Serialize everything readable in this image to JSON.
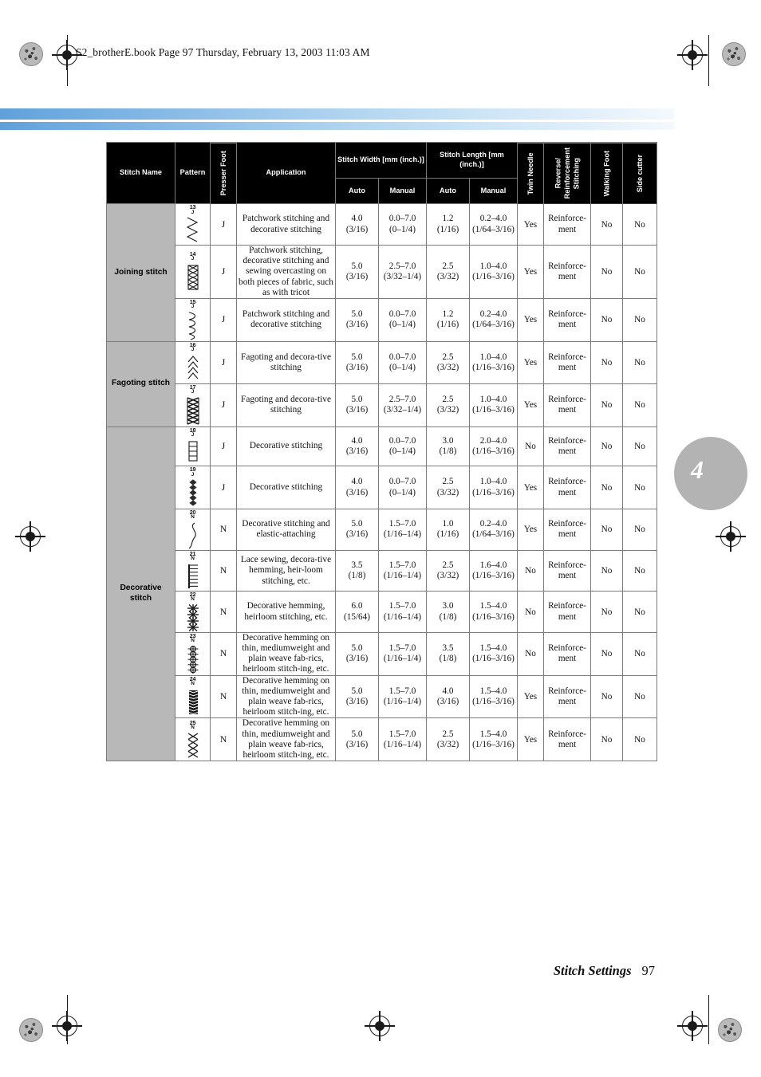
{
  "page_header": "S2_brotherE.book  Page 97  Thursday, February 13, 2003  11:03 AM",
  "chapter_badge": "4",
  "footer": {
    "title": "Stitch Settings",
    "page_number": "97"
  },
  "table": {
    "headers": {
      "stitch_name": "Stitch Name",
      "pattern": "Pattern",
      "presser_foot": "Presser Foot",
      "application": "Application",
      "stitch_width": "Stitch Width",
      "stitch_width_units": "[mm (inch.)]",
      "stitch_length": "Stitch Length",
      "stitch_length_units": "[mm (inch.)]",
      "auto": "Auto",
      "manual": "Manual",
      "auto2": "Auto",
      "manual2": "Manual",
      "twin_needle": "Twin Needle",
      "reverse_line1": "Reverse/",
      "reverse_line2": "Reinforcement",
      "reverse_line3": "Stitching",
      "walking_foot": "Walking Foot",
      "side_cutter": "Side cutter"
    },
    "groups": [
      {
        "label": "Joining stitch",
        "rows": 3
      },
      {
        "label": "Fagoting stitch",
        "rows": 2
      },
      {
        "label": "Decorative\nstitch",
        "rows": 8
      }
    ],
    "rows": [
      {
        "num": "13",
        "foot_mark": "J",
        "glyph": "zigzag-soft",
        "presser_foot": "J",
        "application": "Patchwork stitching and decorative stitching",
        "width_auto": "4.0",
        "width_auto_in": "(3/16)",
        "width_manual": "0.0–7.0",
        "width_manual_in": "(0–1/4)",
        "length_auto": "1.2",
        "length_auto_in": "(1/16)",
        "length_manual": "0.2–4.0",
        "length_manual_in": "(1/64–3/16)",
        "twin_needle": "Yes",
        "reverse": "Reinforce-\nment",
        "walking_foot": "No",
        "side_cutter": "No"
      },
      {
        "num": "14",
        "foot_mark": "J",
        "glyph": "cross-box",
        "presser_foot": "J",
        "application": "Patchwork stitching, decorative stitching and sewing overcasting on both pieces of fabric, such as with tricot",
        "width_auto": "5.0",
        "width_auto_in": "(3/16)",
        "width_manual": "2.5–7.0",
        "width_manual_in": "(3/32–1/4)",
        "length_auto": "2.5",
        "length_auto_in": "(3/32)",
        "length_manual": "1.0–4.0",
        "length_manual_in": "(1/16–3/16)",
        "twin_needle": "Yes",
        "reverse": "Reinforce-\nment",
        "walking_foot": "No",
        "side_cutter": "No"
      },
      {
        "num": "15",
        "foot_mark": "J",
        "glyph": "zigzag-wave",
        "presser_foot": "J",
        "application": "Patchwork stitching and decorative stitching",
        "width_auto": "5.0",
        "width_auto_in": "(3/16)",
        "width_manual": "0.0–7.0",
        "width_manual_in": "(0–1/4)",
        "length_auto": "1.2",
        "length_auto_in": "(1/16)",
        "length_manual": "0.2–4.0",
        "length_manual_in": "(1/64–3/16)",
        "twin_needle": "Yes",
        "reverse": "Reinforce-\nment",
        "walking_foot": "No",
        "side_cutter": "No"
      },
      {
        "num": "16",
        "foot_mark": "J",
        "glyph": "chevron",
        "presser_foot": "J",
        "application": "Fagoting and decora-tive stitching",
        "width_auto": "5.0",
        "width_auto_in": "(3/16)",
        "width_manual": "0.0–7.0",
        "width_manual_in": "(0–1/4)",
        "length_auto": "2.5",
        "length_auto_in": "(3/32)",
        "length_manual": "1.0–4.0",
        "length_manual_in": "(1/16–3/16)",
        "twin_needle": "Yes",
        "reverse": "Reinforce-\nment",
        "walking_foot": "No",
        "side_cutter": "No"
      },
      {
        "num": "17",
        "foot_mark": "J",
        "glyph": "dense-cross",
        "presser_foot": "J",
        "application": "Fagoting and decora-tive stitching",
        "width_auto": "5.0",
        "width_auto_in": "(3/16)",
        "width_manual": "2.5–7.0",
        "width_manual_in": "(3/32–1/4)",
        "length_auto": "2.5",
        "length_auto_in": "(3/32)",
        "length_manual": "1.0–4.0",
        "length_manual_in": "(1/16–3/16)",
        "twin_needle": "Yes",
        "reverse": "Reinforce-\nment",
        "walking_foot": "No",
        "side_cutter": "No"
      },
      {
        "num": "18",
        "foot_mark": "J",
        "glyph": "ladder",
        "presser_foot": "J",
        "application": "Decorative stitching",
        "width_auto": "4.0",
        "width_auto_in": "(3/16)",
        "width_manual": "0.0–7.0",
        "width_manual_in": "(0–1/4)",
        "length_auto": "3.0",
        "length_auto_in": "(1/8)",
        "length_manual": "2.0–4.0",
        "length_manual_in": "(1/16–3/16)",
        "twin_needle": "No",
        "reverse": "Reinforce-\nment",
        "walking_foot": "No",
        "side_cutter": "No"
      },
      {
        "num": "19",
        "foot_mark": "J",
        "glyph": "diamond-chain",
        "presser_foot": "J",
        "application": "Decorative stitching",
        "width_auto": "4.0",
        "width_auto_in": "(3/16)",
        "width_manual": "0.0–7.0",
        "width_manual_in": "(0–1/4)",
        "length_auto": "2.5",
        "length_auto_in": "(3/32)",
        "length_manual": "1.0–4.0",
        "length_manual_in": "(1/16–3/16)",
        "twin_needle": "Yes",
        "reverse": "Reinforce-\nment",
        "walking_foot": "No",
        "side_cutter": "No"
      },
      {
        "num": "20",
        "foot_mark": "N",
        "glyph": "s-curve",
        "presser_foot": "N",
        "application": "Decorative stitching and elastic-attaching",
        "width_auto": "5.0",
        "width_auto_in": "(3/16)",
        "width_manual": "1.5–7.0",
        "width_manual_in": "(1/16–1/4)",
        "length_auto": "1.0",
        "length_auto_in": "(1/16)",
        "length_manual": "0.2–4.0",
        "length_manual_in": "(1/64–3/16)",
        "twin_needle": "Yes",
        "reverse": "Reinforce-\nment",
        "walking_foot": "No",
        "side_cutter": "No"
      },
      {
        "num": "21",
        "foot_mark": "N",
        "glyph": "comb",
        "presser_foot": "N",
        "application": "Lace sewing, decora-tive hemming, heir-loom stitching, etc.",
        "width_auto": "3.5",
        "width_auto_in": "(1/8)",
        "width_manual": "1.5–7.0",
        "width_manual_in": "(1/16–1/4)",
        "length_auto": "2.5",
        "length_auto_in": "(3/32)",
        "length_manual": "1.6–4.0",
        "length_manual_in": "(1/16–3/16)",
        "twin_needle": "No",
        "reverse": "Reinforce-\nment",
        "walking_foot": "No",
        "side_cutter": "No"
      },
      {
        "num": "22",
        "foot_mark": "N",
        "glyph": "asterisk-chain",
        "presser_foot": "N",
        "application": "Decorative hemming, heirloom stitching, etc.",
        "width_auto": "6.0",
        "width_auto_in": "(15/64)",
        "width_manual": "1.5–7.0",
        "width_manual_in": "(1/16–1/4)",
        "length_auto": "3.0",
        "length_auto_in": "(1/8)",
        "length_manual": "1.5–4.0",
        "length_manual_in": "(1/16–3/16)",
        "twin_needle": "No",
        "reverse": "Reinforce-\nment",
        "walking_foot": "No",
        "side_cutter": "No"
      },
      {
        "num": "23",
        "foot_mark": "N",
        "glyph": "circle-chain",
        "presser_foot": "N",
        "application": "Decorative hemming on thin, mediumweight and plain weave fab-rics, heirloom stitch-ing, etc.",
        "width_auto": "5.0",
        "width_auto_in": "(3/16)",
        "width_manual": "1.5–7.0",
        "width_manual_in": "(1/16–1/4)",
        "length_auto": "3.5",
        "length_auto_in": "(1/8)",
        "length_manual": "1.5–4.0",
        "length_manual_in": "(1/16–3/16)",
        "twin_needle": "No",
        "reverse": "Reinforce-\nment",
        "walking_foot": "No",
        "side_cutter": "No"
      },
      {
        "num": "24",
        "foot_mark": "N",
        "glyph": "solid-band",
        "presser_foot": "N",
        "application": "Decorative hemming on thin, mediumweight and plain weave fab-rics, heirloom stitch-ing, etc.",
        "width_auto": "5.0",
        "width_auto_in": "(3/16)",
        "width_manual": "1.5–7.0",
        "width_manual_in": "(1/16–1/4)",
        "length_auto": "4.0",
        "length_auto_in": "(3/16)",
        "length_manual": "1.5–4.0",
        "length_manual_in": "(1/16–3/16)",
        "twin_needle": "Yes",
        "reverse": "Reinforce-\nment",
        "walking_foot": "No",
        "side_cutter": "No"
      },
      {
        "num": "25",
        "foot_mark": "N",
        "glyph": "lattice",
        "presser_foot": "N",
        "application": "Decorative hemming on thin, mediumweight and plain weave fab-rics, heirloom stitch-ing, etc.",
        "width_auto": "5.0",
        "width_auto_in": "(3/16)",
        "width_manual": "1.5–7.0",
        "width_manual_in": "(1/16–1/4)",
        "length_auto": "2.5",
        "length_auto_in": "(3/32)",
        "length_manual": "1.5–4.0",
        "length_manual_in": "(1/16–3/16)",
        "twin_needle": "Yes",
        "reverse": "Reinforce-\nment",
        "walking_foot": "No",
        "side_cutter": "No"
      }
    ]
  }
}
